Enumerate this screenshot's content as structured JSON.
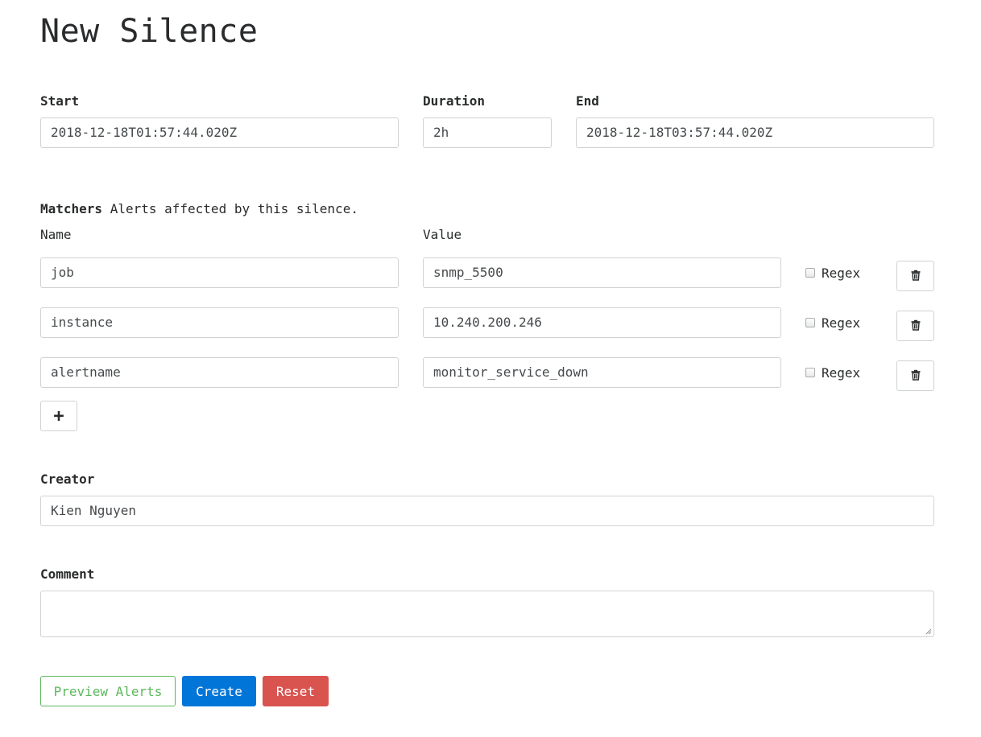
{
  "page_title": "New Silence",
  "time": {
    "start_label": "Start",
    "start_value": "2018-12-18T01:57:44.020Z",
    "duration_label": "Duration",
    "duration_value": "2h",
    "end_label": "End",
    "end_value": "2018-12-18T03:57:44.020Z"
  },
  "matchers": {
    "title": "Matchers",
    "description": "Alerts affected by this silence.",
    "name_header": "Name",
    "value_header": "Value",
    "regex_label": "Regex",
    "rows": [
      {
        "name": "job",
        "value": "snmp_5500",
        "regex": false
      },
      {
        "name": "instance",
        "value": "10.240.200.246",
        "regex": false
      },
      {
        "name": "alertname",
        "value": "monitor_service_down",
        "regex": false
      }
    ],
    "add_label": "+"
  },
  "creator": {
    "label": "Creator",
    "value": "Kien Nguyen"
  },
  "comment": {
    "label": "Comment",
    "value": ""
  },
  "actions": {
    "preview_label": "Preview Alerts",
    "create_label": "Create",
    "reset_label": "Reset"
  },
  "colors": {
    "primary": "#0275d8",
    "danger": "#d9534f",
    "success": "#5cb85c",
    "text": "#292b2c",
    "border": "#cfd2d4"
  },
  "icons": {
    "delete": "trash-icon",
    "add": "plus-icon"
  }
}
